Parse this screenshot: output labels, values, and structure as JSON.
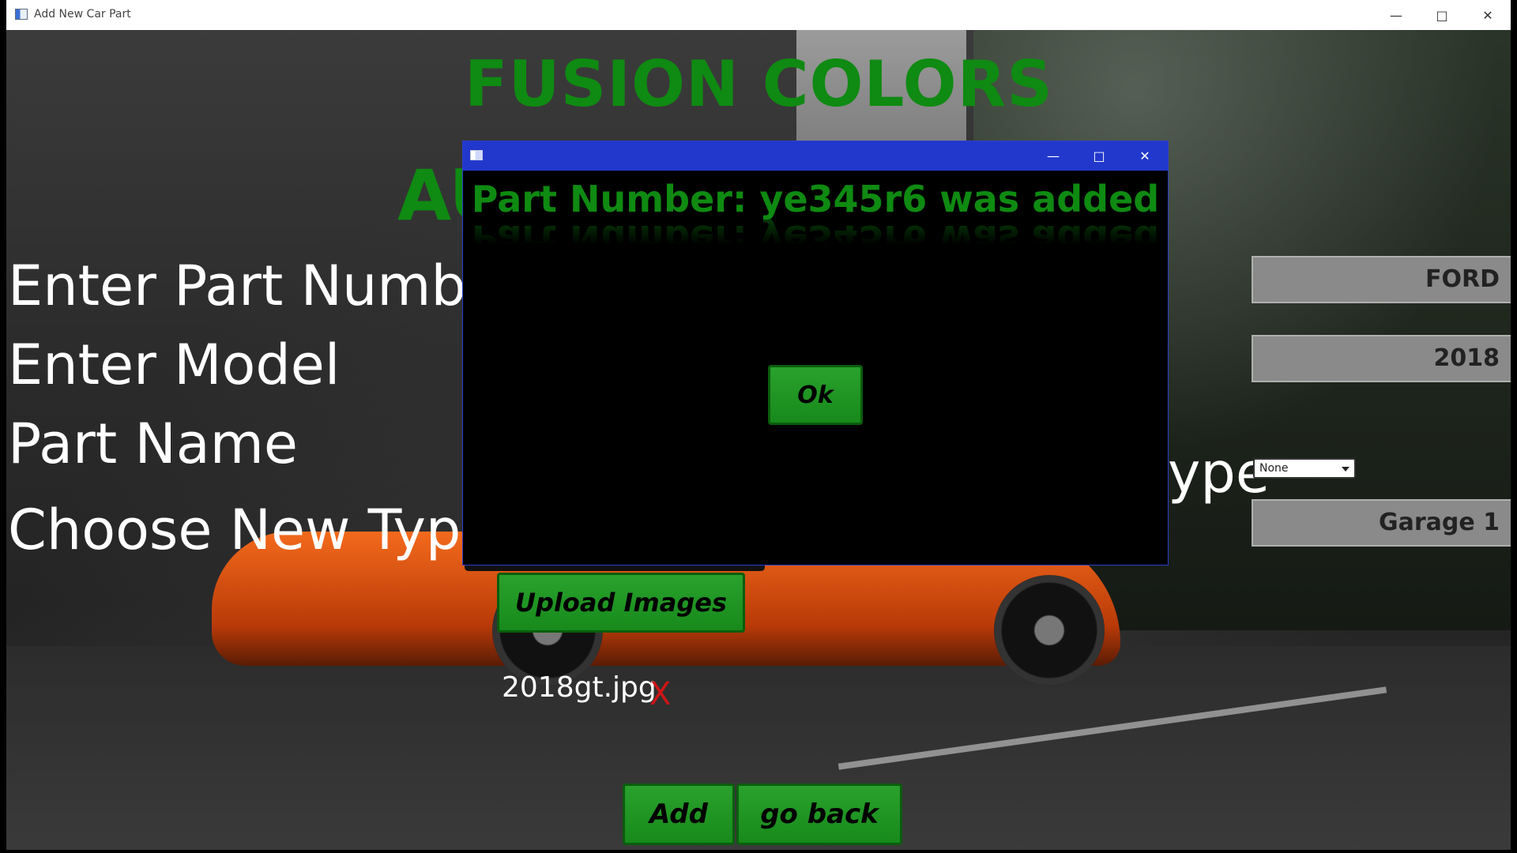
{
  "window": {
    "title": "Add New Car Part"
  },
  "header": {
    "brand": "FUSION COLORS",
    "subtitle_partial": "AU"
  },
  "form": {
    "labels": {
      "part_number": "Enter Part Numbe",
      "model": "Enter Model",
      "part_name": "Part Name",
      "choose_type": "Choose New Type",
      "type_tail": "ype"
    },
    "fields": {
      "make": "FORD",
      "year": "2018",
      "type_select": "None",
      "location": "Garage 1"
    },
    "upload_button": "Upload Images",
    "uploaded_file": "2018gt.jpg",
    "remove_file": "X",
    "add_button": "Add",
    "back_button": "go back"
  },
  "dialog": {
    "message": "Part Number: ye345r6 was added",
    "ok_button": "Ok"
  },
  "colors": {
    "brand_green": "#0f8a12",
    "button_green": "#1f961f",
    "dialog_title_blue": "#2238cc",
    "remove_red": "#d01515"
  }
}
